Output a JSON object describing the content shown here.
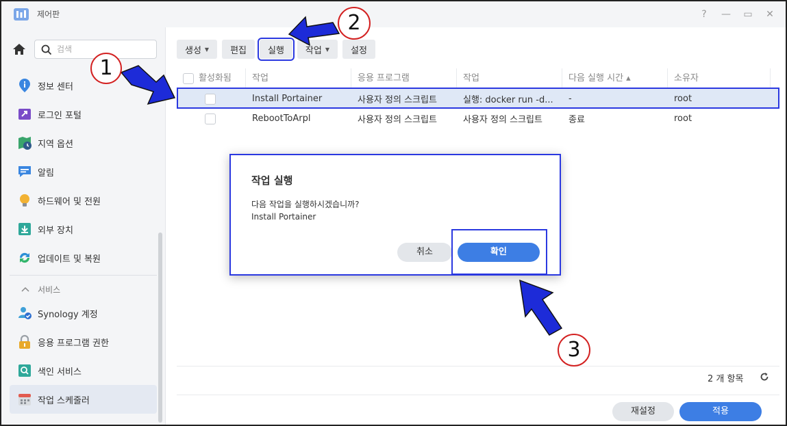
{
  "window": {
    "title": "제어판",
    "controls": [
      "?",
      "—",
      "▭",
      "✕"
    ]
  },
  "sidebar": {
    "search_placeholder": "검색",
    "items": [
      {
        "label": "정보 센터",
        "icon": "info-center-icon",
        "color": "#3a86e0"
      },
      {
        "label": "로그인 포털",
        "icon": "login-portal-icon",
        "color": "#7a4cc8"
      },
      {
        "label": "지역 옵션",
        "icon": "regional-options-icon",
        "color": "#3aa56c"
      },
      {
        "label": "알림",
        "icon": "notification-icon",
        "color": "#3a86e0"
      },
      {
        "label": "하드웨어 및 전원",
        "icon": "hardware-power-icon",
        "color": "#f2b233"
      },
      {
        "label": "외부 장치",
        "icon": "external-devices-icon",
        "color": "#2fa89a"
      },
      {
        "label": "업데이트 및 복원",
        "icon": "update-restore-icon",
        "color": "#2d8fd6"
      }
    ],
    "group_label": "서비스",
    "service_items": [
      {
        "label": "Synology 계정",
        "icon": "synology-account-icon",
        "color": "#3fa0d8"
      },
      {
        "label": "응용 프로그램 권한",
        "icon": "app-privileges-icon",
        "color": "#e8a92a"
      },
      {
        "label": "색인 서비스",
        "icon": "indexing-service-icon",
        "color": "#2fa89a"
      },
      {
        "label": "작업 스케줄러",
        "icon": "task-scheduler-icon",
        "color": "#e25b4f"
      }
    ]
  },
  "toolbar": {
    "create": "생성",
    "edit": "편집",
    "run": "실행",
    "action": "작업",
    "settings": "설정"
  },
  "table": {
    "headers": [
      "활성화됨",
      "작업",
      "응용 프로그램",
      "작업",
      "다음 실행 시간 ▴",
      "소유자"
    ],
    "rows": [
      {
        "task": "Install Portainer",
        "app": "사용자 정의 스크립트",
        "action": "실행: docker run -d...",
        "next_run": "-",
        "owner": "root"
      },
      {
        "task": "RebootToArpl",
        "app": "사용자 정의 스크립트",
        "action": "사용자 정의 스크립트",
        "next_run": "종료",
        "owner": "root"
      }
    ]
  },
  "footer": {
    "count": "2 개 항목",
    "reset": "재설정",
    "apply": "적용"
  },
  "dialog": {
    "title": "작업 실행",
    "message": "다음 작업을 실행하시겠습니까?",
    "task": "Install Portainer",
    "cancel": "취소",
    "ok": "확인"
  },
  "annotations": {
    "step1": "1",
    "step2": "2",
    "step3": "3"
  },
  "colors": {
    "accent": "#3d7ee4",
    "highlight": "#2a38e0",
    "badge_ring": "#d32121"
  }
}
